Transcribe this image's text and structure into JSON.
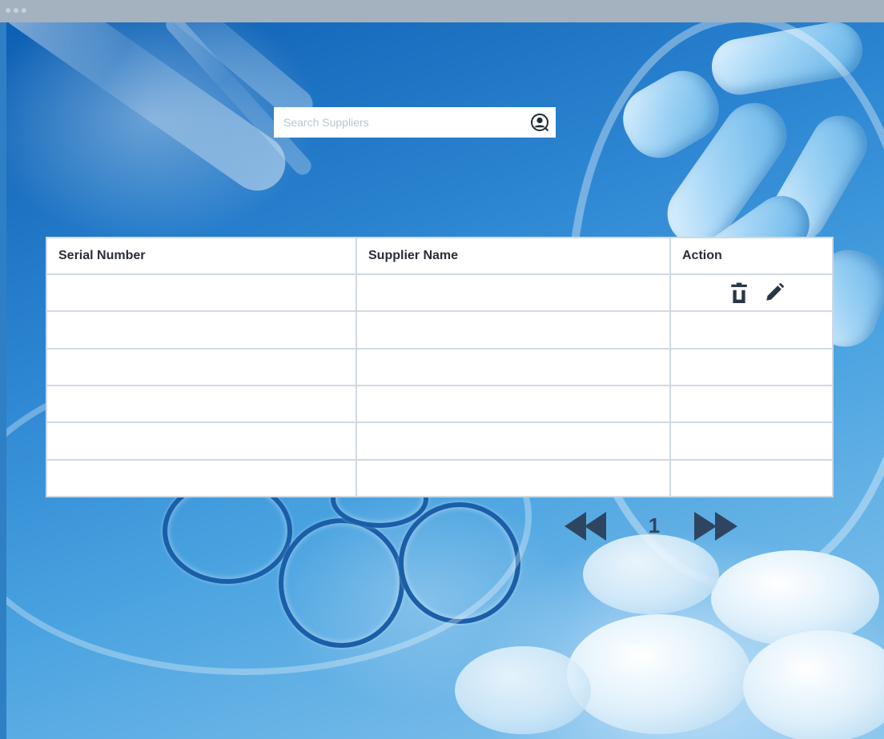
{
  "search": {
    "placeholder": "Search Suppliers",
    "icon": "user-circle-icon"
  },
  "table": {
    "columns": [
      "Serial Number",
      "Supplier Name",
      "Action"
    ],
    "rows": [
      {
        "serial": "",
        "supplier": "",
        "actions": [
          "trash-icon",
          "pencil-icon"
        ]
      },
      {
        "serial": "",
        "supplier": ""
      },
      {
        "serial": "",
        "supplier": ""
      },
      {
        "serial": "",
        "supplier": ""
      },
      {
        "serial": "",
        "supplier": ""
      },
      {
        "serial": "",
        "supplier": ""
      }
    ]
  },
  "pagination": {
    "current_page": "1",
    "prev_icon": "rewind-icon",
    "next_icon": "fast-forward-icon"
  },
  "colors": {
    "titlebar": "#a4b1bf",
    "table_border": "#cfd9e3",
    "icon": "#2b3644",
    "pager": "#2e4561"
  }
}
